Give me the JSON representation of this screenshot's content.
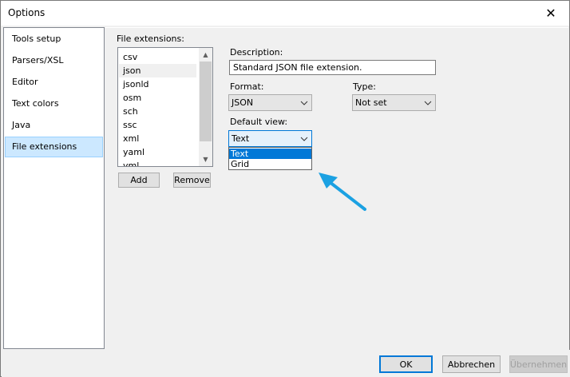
{
  "window": {
    "title": "Options"
  },
  "nav": {
    "items": [
      {
        "label": "Tools setup",
        "selected": false
      },
      {
        "label": "Parsers/XSL",
        "selected": false
      },
      {
        "label": "Editor",
        "selected": false
      },
      {
        "label": "Text colors",
        "selected": false
      },
      {
        "label": "Java",
        "selected": false
      },
      {
        "label": "File extensions",
        "selected": true
      }
    ]
  },
  "extensions": {
    "label": "File extensions:",
    "items": [
      "csv",
      "json",
      "jsonld",
      "osm",
      "sch",
      "ssc",
      "xml",
      "yaml",
      "yml"
    ],
    "selected": "json",
    "add_label": "Add",
    "remove_label": "Remove"
  },
  "description": {
    "label": "Description:",
    "value": "Standard JSON file extension."
  },
  "format": {
    "label": "Format:",
    "value": "JSON"
  },
  "type": {
    "label": "Type:",
    "value": "Not set"
  },
  "default_view": {
    "label": "Default view:",
    "value": "Text",
    "options": [
      "Text",
      "Grid"
    ],
    "highlighted": "Text"
  },
  "footer": {
    "ok_label": "OK",
    "cancel_label": "Abbrechen",
    "apply_label": "Übernehmen"
  },
  "colors": {
    "accent": "#0078d7",
    "selection": "#cce8ff",
    "annotation_arrow": "#1ba1e2"
  }
}
